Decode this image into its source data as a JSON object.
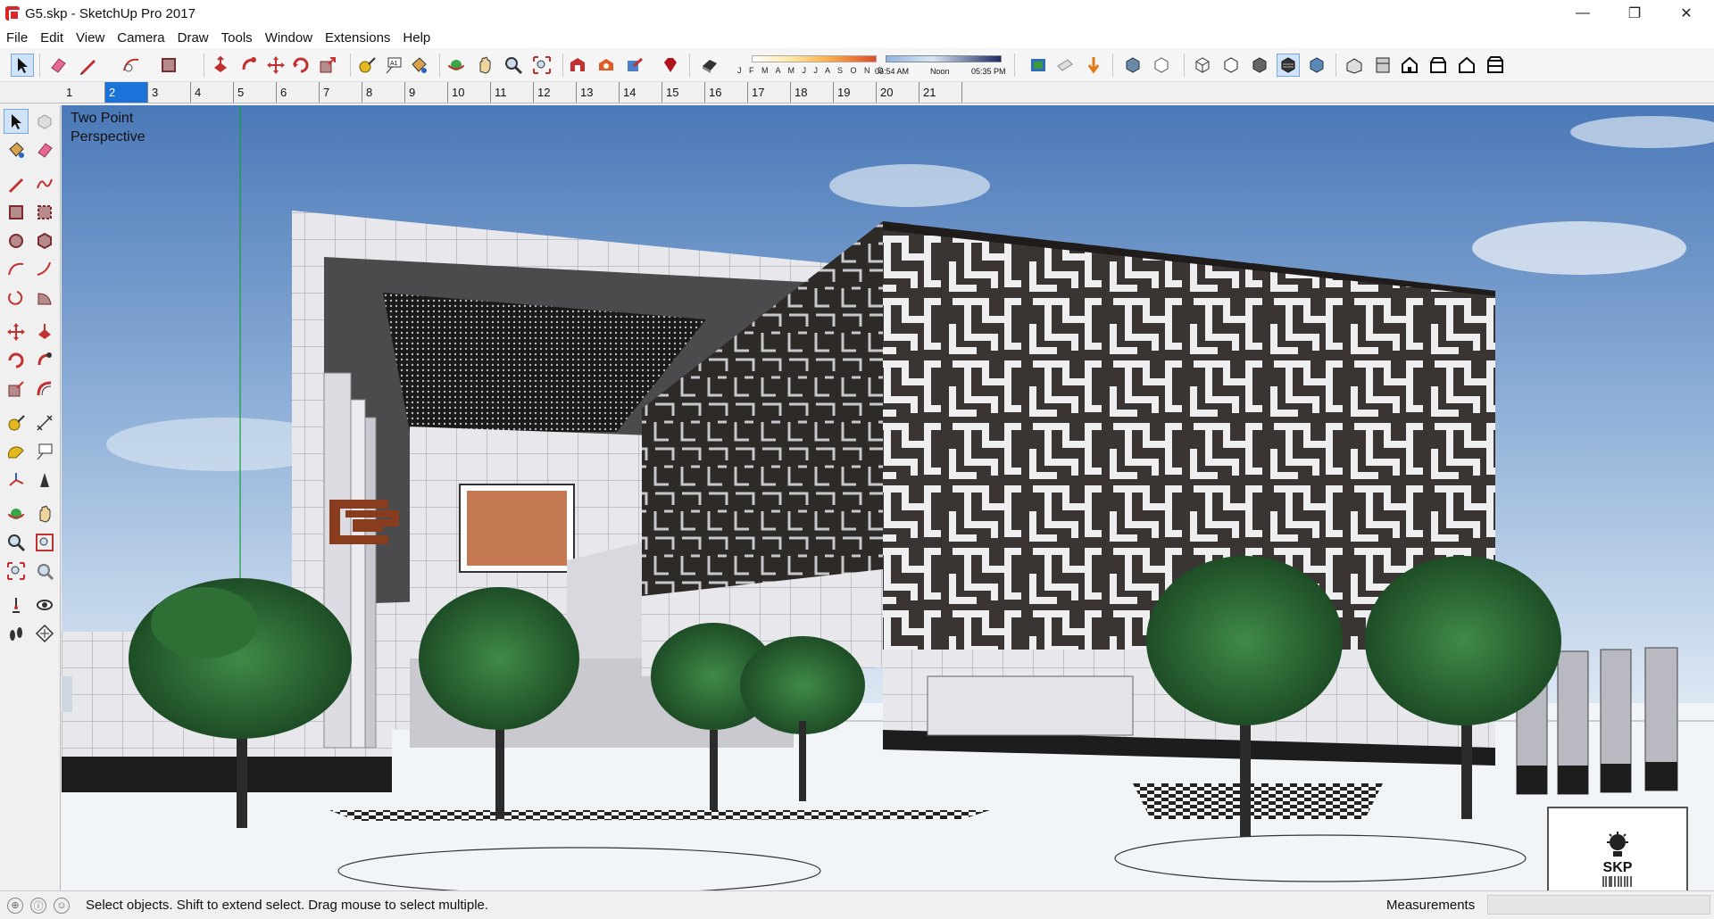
{
  "window": {
    "title": "G5.skp - SketchUp Pro 2017",
    "minimize_glyph": "—",
    "maximize_glyph": "❐",
    "close_glyph": "✕"
  },
  "menu": [
    "File",
    "Edit",
    "View",
    "Camera",
    "Draw",
    "Tools",
    "Window",
    "Extensions",
    "Help"
  ],
  "shadow": {
    "months": "J F M A M J J A S O N D",
    "time_start": "06:54 AM",
    "time_mid": "Noon",
    "time_end": "05:35 PM"
  },
  "scenes": {
    "tabs": [
      "1",
      "2",
      "3",
      "4",
      "5",
      "6",
      "7",
      "8",
      "9",
      "10",
      "11",
      "12",
      "13",
      "14",
      "15",
      "16",
      "17",
      "18",
      "19",
      "20",
      "21"
    ],
    "active_index": 1
  },
  "viewport": {
    "camera_label_line1": "Two Point",
    "camera_label_line2": "Perspective",
    "badge_text": "SKP"
  },
  "status": {
    "hint": "Select objects. Shift to extend select. Drag mouse to select multiple.",
    "measurements_label": "Measurements",
    "measurements_value": ""
  },
  "colors": {
    "accent": "#1a73d9",
    "sky_top": "#4a79b8",
    "sky_bottom": "#dfe9f4",
    "facade_dark": "#2f2b29",
    "facade_light": "#e8e8ec",
    "foliage": "#2b6a34"
  },
  "icons": {
    "toolbar": [
      "select-icon",
      "eraser-icon",
      "pencil-icon",
      "arc-icon",
      "rectangle-icon",
      "push-pull-icon",
      "follow-me-icon",
      "move-icon",
      "rotate-icon",
      "scale-icon",
      "tape-icon",
      "text-icon",
      "paint-icon",
      "orbit-icon",
      "pan-icon",
      "zoom-icon",
      "zoom-extents-icon",
      "warehouse-icon",
      "extension-icon",
      "share-icon",
      "ruby-icon",
      "shadow-toggle-icon",
      "fog-icon",
      "section-icon",
      "layer-icon",
      "xray-icon",
      "back-edges-icon",
      "wireframe-icon",
      "hidden-line-icon",
      "shaded-icon",
      "textured-icon",
      "monochrome-icon",
      "iso-icon",
      "top-icon",
      "front-icon",
      "right-icon",
      "back-icon",
      "left-icon"
    ]
  }
}
